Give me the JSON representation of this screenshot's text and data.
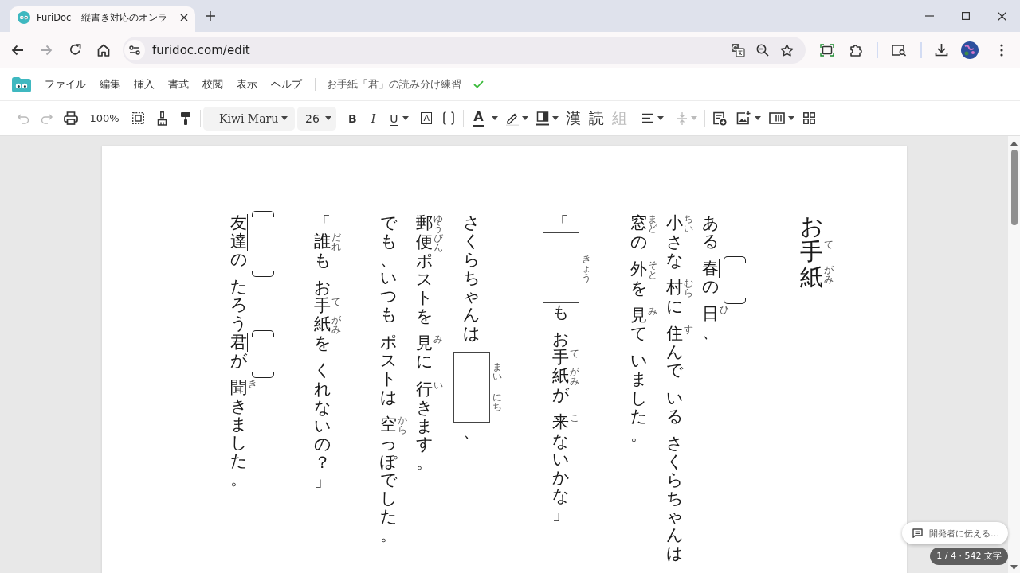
{
  "browser": {
    "tabs": [
      {
        "title": "FuriDoc – 縦書き対応のオンラ",
        "selected": true
      }
    ],
    "back": {
      "disabled": false
    },
    "forward": {
      "disabled": true
    },
    "url": "furidoc.com/edit"
  },
  "app": {
    "menus": [
      "ファイル",
      "編集",
      "挿入",
      "書式",
      "校閲",
      "表示",
      "ヘルプ"
    ],
    "doc_title": "お手紙「君」の読み分け練習",
    "saved": true
  },
  "toolbar": {
    "undo": {
      "disabled": true
    },
    "redo": {
      "disabled": true
    },
    "zoom": "100%",
    "font": "Kiwi Maru",
    "font_size": "26",
    "styles": [
      "B",
      "I",
      "U"
    ],
    "boxed_letter": "A",
    "color_letter": "A",
    "script_tools": [
      {
        "label": "漢",
        "disabled": false
      },
      {
        "label": "読",
        "disabled": false
      },
      {
        "label": "組",
        "disabled": true
      }
    ],
    "line_spacing": {
      "disabled": true
    }
  },
  "document": {
    "paragraphs": [
      {
        "columns": [
          {
            "phrases": [
              [
                {
                  "kind": "bracket",
                  "base": "友達"
                },
                {
                  "kind": "text",
                  "text": "の"
                }
              ],
              [
                {
                  "kind": "text",
                  "text": "たろう"
                },
                {
                  "kind": "bracket",
                  "base": "君"
                },
                {
                  "kind": "text",
                  "text": "が"
                }
              ],
              [
                {
                  "kind": "ruby",
                  "base": "聞",
                  "reading": "き"
                },
                {
                  "kind": "text",
                  "text": "きました。"
                }
              ]
            ]
          }
        ]
      },
      {
        "columns": [
          {
            "phrases": [
              [
                {
                  "kind": "text",
                  "text": "「"
                },
                {
                  "kind": "ruby",
                  "base": "誰",
                  "reading": "だれ"
                },
                {
                  "kind": "text",
                  "text": "も"
                }
              ],
              [
                {
                  "kind": "text",
                  "text": "お"
                },
                {
                  "kind": "ruby",
                  "base": "手",
                  "reading": "て"
                },
                {
                  "kind": "ruby",
                  "base": "紙",
                  "reading": "がみ"
                },
                {
                  "kind": "text",
                  "text": "を"
                }
              ],
              [
                {
                  "kind": "text",
                  "text": "くれないの？」"
                }
              ]
            ]
          }
        ]
      },
      {
        "columns": [
          {
            "phrases": [
              [
                {
                  "kind": "text",
                  "text": "でも、いつも"
                }
              ],
              [
                {
                  "kind": "text",
                  "text": "ポストは"
                }
              ],
              [
                {
                  "kind": "ruby",
                  "base": "空",
                  "reading": "から"
                },
                {
                  "kind": "text",
                  "text": "っぽでした。"
                }
              ]
            ]
          },
          {
            "phrases": [
              [
                {
                  "kind": "ruby",
                  "base": "郵",
                  "reading": "ゆう"
                },
                {
                  "kind": "ruby",
                  "base": "便",
                  "reading": "びん"
                },
                {
                  "kind": "text",
                  "text": "ポストを"
                }
              ],
              [
                {
                  "kind": "ruby",
                  "base": "見",
                  "reading": "み"
                },
                {
                  "kind": "text",
                  "text": "に"
                }
              ],
              [
                {
                  "kind": "ruby",
                  "base": "行",
                  "reading": "い"
                },
                {
                  "kind": "text",
                  "text": "きます。"
                }
              ]
            ]
          },
          {
            "phrases": [
              [
                {
                  "kind": "text",
                  "text": "さくらちゃんは"
                }
              ],
              [
                {
                  "kind": "box",
                  "readings": [
                    "まい",
                    "にち"
                  ]
                },
                {
                  "kind": "text",
                  "text": "、"
                }
              ]
            ]
          }
        ]
      },
      {
        "columns": [
          {
            "phrases": [
              [
                {
                  "kind": "text",
                  "text": "「"
                },
                {
                  "kind": "box",
                  "readings": [
                    "きょう"
                  ]
                },
                {
                  "kind": "text",
                  "text": "も"
                }
              ],
              [
                {
                  "kind": "text",
                  "text": "お"
                },
                {
                  "kind": "ruby",
                  "base": "手",
                  "reading": "て"
                },
                {
                  "kind": "ruby",
                  "base": "紙",
                  "reading": "がみ"
                },
                {
                  "kind": "text",
                  "text": "が"
                }
              ],
              [
                {
                  "kind": "ruby",
                  "base": "来",
                  "reading": "こ"
                },
                {
                  "kind": "text",
                  "text": "ないかな」"
                }
              ]
            ]
          }
        ]
      },
      {
        "columns": [
          {
            "phrases": [
              [
                {
                  "kind": "ruby",
                  "base": "窓",
                  "reading": "まど"
                },
                {
                  "kind": "text",
                  "text": "の"
                }
              ],
              [
                {
                  "kind": "ruby",
                  "base": "外",
                  "reading": "そと"
                },
                {
                  "kind": "text",
                  "text": "を"
                }
              ],
              [
                {
                  "kind": "ruby",
                  "base": "見",
                  "reading": "み"
                },
                {
                  "kind": "text",
                  "text": "て"
                }
              ],
              [
                {
                  "kind": "text",
                  "text": "いました。"
                }
              ]
            ]
          },
          {
            "phrases": [
              [
                {
                  "kind": "ruby",
                  "base": "小",
                  "reading": "ちい"
                },
                {
                  "kind": "text",
                  "text": "さな"
                }
              ],
              [
                {
                  "kind": "ruby",
                  "base": "村",
                  "reading": "むら"
                },
                {
                  "kind": "text",
                  "text": "に"
                }
              ],
              [
                {
                  "kind": "ruby",
                  "base": "住",
                  "reading": "す"
                },
                {
                  "kind": "text",
                  "text": "んで"
                }
              ],
              [
                {
                  "kind": "text",
                  "text": "いる"
                }
              ],
              [
                {
                  "kind": "text",
                  "text": "さくらちゃんは"
                }
              ]
            ]
          },
          {
            "phrases": [
              [
                {
                  "kind": "text",
                  "text": "ある"
                }
              ],
              [
                {
                  "kind": "bracket",
                  "base": "春"
                },
                {
                  "kind": "text",
                  "text": "の"
                }
              ],
              [
                {
                  "kind": "ruby",
                  "base": "日",
                  "reading": "ひ"
                },
                {
                  "kind": "text",
                  "text": "、"
                }
              ]
            ]
          }
        ]
      }
    ],
    "title": {
      "phrases": [
        [
          {
            "kind": "text",
            "text": "お"
          },
          {
            "kind": "ruby",
            "base": "手",
            "reading": "て"
          },
          {
            "kind": "ruby",
            "base": "紙",
            "reading": "がみ"
          }
        ]
      ]
    }
  },
  "feedback": "開発者に伝える…",
  "status": "1 / 4 · 542 文字"
}
